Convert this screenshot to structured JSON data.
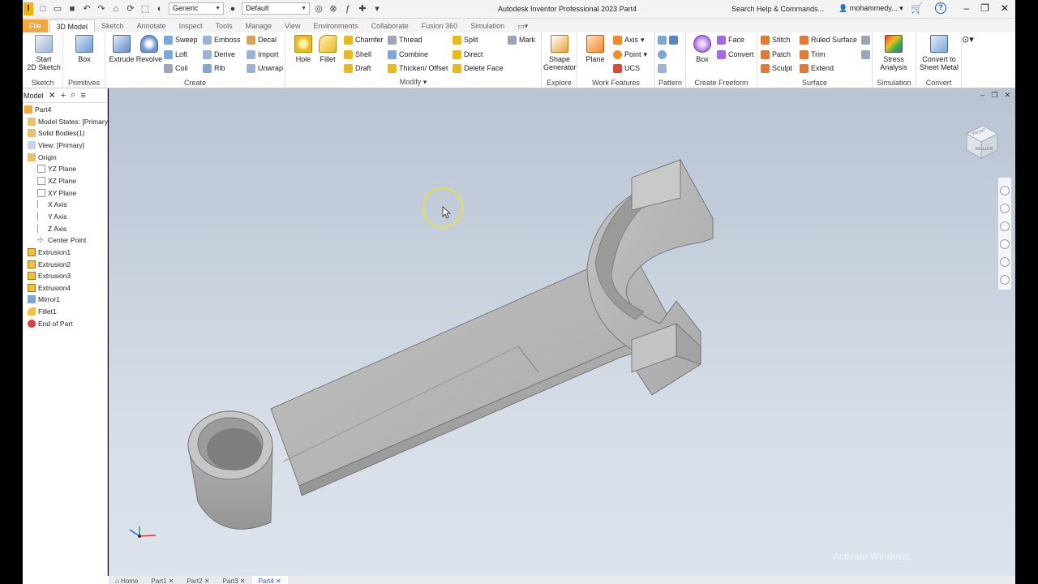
{
  "titlebar": {
    "app_letter": "I",
    "material": "Generic",
    "appearance": "Default",
    "title": "Autodesk Inventor Professional 2023   Part4",
    "search_placeholder": "Search Help & Commands...",
    "user": "mohammedy...",
    "help": "?"
  },
  "tabs": [
    "File",
    "3D Model",
    "Sketch",
    "Annotate",
    "Inspect",
    "Tools",
    "Manage",
    "View",
    "Environments",
    "Collaborate",
    "Fusion 360",
    "Simulation"
  ],
  "ribbon": {
    "sketch": {
      "title": "Sketch",
      "start": "Start\n2D Sketch"
    },
    "primitives": {
      "title": "Primitives",
      "box": "Box"
    },
    "create": {
      "title": "Create",
      "extrude": "Extrude",
      "revolve": "Revolve",
      "sweep": "Sweep",
      "emboss": "Emboss",
      "decal": "Decal",
      "loft": "Loft",
      "derive": "Derive",
      "import": "Import",
      "coil": "Coil",
      "rib": "Rib",
      "unwrap": "Unwrap"
    },
    "modify": {
      "title": "Modify",
      "hole": "Hole",
      "fillet": "Fillet",
      "chamfer": "Chamfer",
      "thread": "Thread",
      "split": "Split",
      "shell": "Shell",
      "combine": "Combine",
      "direct": "Direct",
      "draft": "Draft",
      "thicken": "Thicken/ Offset",
      "delete_face": "Delete Face",
      "mark": "Mark"
    },
    "explore": {
      "title": "Explore",
      "shape_generator": "Shape\nGenerator"
    },
    "work_features": {
      "title": "Work Features",
      "plane": "Plane",
      "axis": "Axis",
      "point": "Point",
      "ucs": "UCS"
    },
    "pattern": {
      "title": "Pattern"
    },
    "freeform": {
      "title": "Create Freeform",
      "box": "Box",
      "face": "Face",
      "convert": "Convert"
    },
    "surface": {
      "title": "Surface",
      "stitch": "Stitch",
      "ruled": "Ruled Surface",
      "patch": "Patch",
      "trim": "Trim",
      "sculpt": "Sculpt",
      "extend": "Extend"
    },
    "simulation": {
      "title": "Simulation",
      "stress": "Stress\nAnalysis"
    },
    "convert": {
      "title": "Convert",
      "sheet_metal": "Convert to\nSheet Metal"
    }
  },
  "browser": {
    "tab_label": "Model",
    "items": [
      {
        "label": "Part4"
      },
      {
        "label": "Model States: [Primary]"
      },
      {
        "label": "Solid Bodies(1)"
      },
      {
        "label": "View: [Primary]"
      },
      {
        "label": "Origin"
      },
      {
        "label": "YZ Plane"
      },
      {
        "label": "XZ Plane"
      },
      {
        "label": "XY Plane"
      },
      {
        "label": "X Axis"
      },
      {
        "label": "Y Axis"
      },
      {
        "label": "Z Axis"
      },
      {
        "label": "Center Point"
      },
      {
        "label": "Extrusion1"
      },
      {
        "label": "Extrusion2"
      },
      {
        "label": "Extrusion3"
      },
      {
        "label": "Extrusion4"
      },
      {
        "label": "Mirror1"
      },
      {
        "label": "Fillet1"
      },
      {
        "label": "End of Part"
      }
    ]
  },
  "viewport": {
    "viewcube_front": "FRONT",
    "viewcube_bottom": "BOTTOM",
    "watermark": "Activate Windows"
  },
  "doc_tabs": [
    "Home",
    "Part1",
    "Part2",
    "Part3",
    "Part4"
  ],
  "colors": {
    "file_tab": "#f2a93b",
    "accent": "#1a5bbd",
    "viewport_top": "#b9c4d4",
    "viewport_bottom": "#dde3ec",
    "part_gray": "#b8b8b8"
  }
}
